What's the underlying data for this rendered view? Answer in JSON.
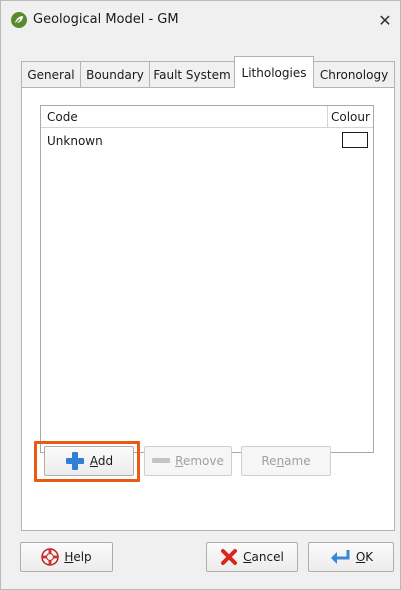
{
  "window": {
    "title": "Geological Model - GM",
    "app_icon": "leaf-icon",
    "close_glyph": "✕"
  },
  "tabs": [
    {
      "label": "General"
    },
    {
      "label": "Boundary"
    },
    {
      "label": "Fault System"
    },
    {
      "label": "Lithologies",
      "active": true
    },
    {
      "label": "Chronology"
    }
  ],
  "lithologies": {
    "columns": {
      "code": "Code",
      "colour": "Colour"
    },
    "rows": [
      {
        "code": "Unknown",
        "colour": "#ffffff"
      }
    ]
  },
  "list_buttons": {
    "add": {
      "mnemonic": "A",
      "rest": "dd",
      "icon": "plus-icon",
      "enabled": true
    },
    "remove": {
      "mnemonic": "R",
      "rest": "emove",
      "icon": "minus-icon",
      "enabled": false
    },
    "rename": {
      "pre": "Re",
      "mnemonic": "n",
      "rest": "ame",
      "enabled": false
    }
  },
  "dialog_buttons": {
    "help": {
      "mnemonic": "H",
      "rest": "elp",
      "icon": "lifebuoy-icon"
    },
    "cancel": {
      "mnemonic": "C",
      "rest": "ancel",
      "icon": "red-x-icon"
    },
    "ok": {
      "mnemonic": "O",
      "rest": "K",
      "icon": "return-arrow-icon"
    }
  },
  "colors": {
    "highlight": "#ea5a12",
    "plus_icon": "#2f7fd6",
    "cancel_icon": "#d9261c"
  }
}
